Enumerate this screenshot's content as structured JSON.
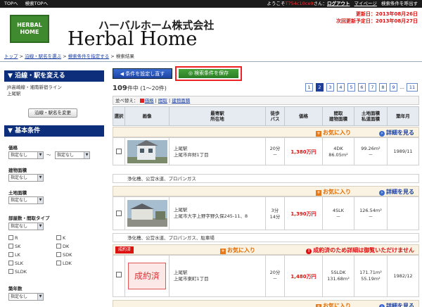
{
  "topbar": {
    "links": [
      "TOPへ",
      "検索TOPへ"
    ],
    "welcome_prefix": "ようこそ",
    "user": "T754c10ce9",
    "welcome_suffix": "さん",
    "logout": "ログアウト",
    "mypage": "マイページ",
    "saved": "検索条件を呼出す"
  },
  "header": {
    "logo_text": [
      "HERBAL",
      "HOME"
    ],
    "company_jp": "ハーバルホーム株式会社",
    "company_en": "Herbal Home",
    "updated": "更新日：2013年08月26日",
    "next_update": "次回更新予定日：2013年08月27日"
  },
  "breadcrumb": {
    "items": [
      "トップ",
      "沿線・駅名を選ぶ",
      "検索条件を指定する",
      "検索結果"
    ],
    "sep": ">"
  },
  "sidebar": {
    "line_title": "沿線・駅を変える",
    "line_name": "JR高崎線・湘南新宿ライン",
    "station": "上尾駅",
    "change_button": "沿線・駅名を変更",
    "basic_title": "基本条件",
    "price_label": "価格",
    "price_from": "指定なし",
    "price_tilde": "～",
    "price_to": "指定なし",
    "building_area_label": "建物面積",
    "building_area": "指定なし",
    "land_area_label": "土地面積",
    "land_area": "指定なし",
    "layout_label": "部屋数・間取タイプ",
    "rooms": "指定なし",
    "layout_types": [
      "R",
      "K",
      "SK",
      "DK",
      "LK",
      "SDK",
      "SLK",
      "LDK",
      "SLDK"
    ],
    "age_label": "築年数",
    "age": "指定なし"
  },
  "main": {
    "reset_button": "条件を設定し直す",
    "save_button": "検索条件を保存",
    "count": "109",
    "count_suffix": "件中",
    "range": "(1～20件)",
    "pages": [
      "1",
      "2",
      "3",
      "4",
      "5",
      "6",
      "7",
      "8",
      "9",
      "…",
      "11"
    ],
    "current_page": "2",
    "sort_prefix": "並べ替え：",
    "sort_options": [
      "価格",
      "間取",
      "建物面積"
    ],
    "headers": [
      "選択",
      "画像",
      "最寄駅\n所在地",
      "徒歩\nバス",
      "価格",
      "間取\n建物面積",
      "土地面積\n私道面積",
      "築年月"
    ],
    "fav_label": "お気に入り",
    "detail_label": "詳細を見る",
    "listings": [
      {
        "station": "上尾駅",
        "address": "上尾市弁財1丁目",
        "walk": "20分",
        "bus": "－",
        "price": "1,380万円",
        "layout": "4DK",
        "building_area": "86.05m²",
        "land_area": "99.26m²",
        "road_area": "－",
        "built": "1989/11",
        "note": "浄化槽、公営水道、プロパンガス"
      },
      {
        "station": "上尾駅",
        "address": "上尾市大字上野字野久保245-11、8",
        "walk": "3分",
        "bus": "14分",
        "price": "1,390万円",
        "layout": "4SLK",
        "building_area": "－",
        "land_area": "126.54m²",
        "road_area": "－",
        "built": "",
        "note": "浄化槽、公営水道、プロパンガス、駐車場"
      },
      {
        "station": "上尾駅",
        "address": "上尾市東町1丁目",
        "walk": "20分",
        "bus": "－",
        "price": "1,480万円",
        "layout": "5SLDK",
        "building_area": "131.68m²",
        "land_area": "171.71m²",
        "road_area": "55.19m²",
        "built": "1982/12",
        "sold_badge": "成約済",
        "sold_image": "成約済",
        "sold_notice": "成約済のため詳細は御覧いただけません"
      }
    ]
  }
}
